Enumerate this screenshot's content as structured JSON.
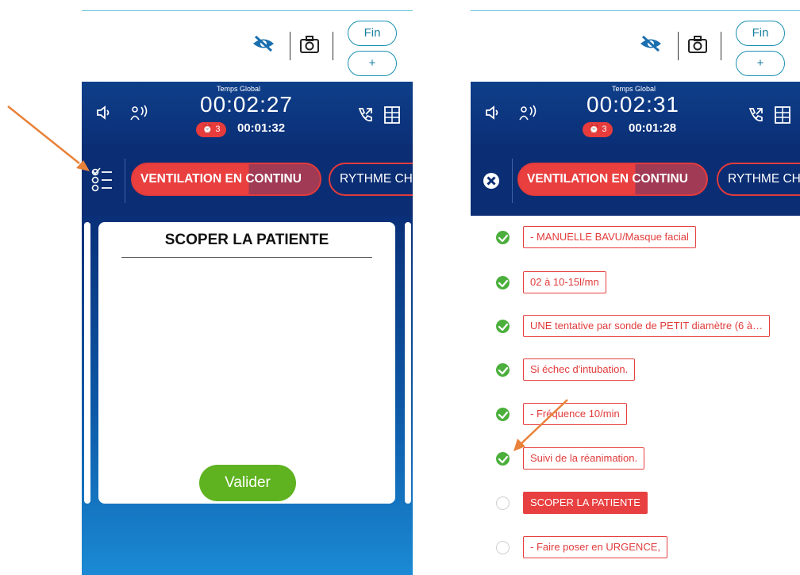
{
  "left_screen": {
    "top": {
      "end_label": "Fin",
      "add_label": "+"
    },
    "header": {
      "global_time_label": "Temps Global",
      "global_timer": "00:02:27",
      "alarm_count": "3",
      "sub_timer": "00:01:32"
    },
    "tabs": {
      "active": "VENTILATION EN CONTINU",
      "next": "RYTHME CH"
    },
    "card": {
      "title": "SCOPER LA PATIENTE",
      "validate_label": "Valider"
    }
  },
  "right_screen": {
    "top": {
      "end_label": "Fin",
      "add_label": "+"
    },
    "header": {
      "global_time_label": "Temps Global",
      "global_timer": "00:02:31",
      "alarm_count": "3",
      "sub_timer": "00:01:28"
    },
    "tabs": {
      "active": "VENTILATION EN CONTINU",
      "next": "RYTHME CH"
    },
    "checklist": [
      {
        "label": "- MANUELLE BAVU/Masque facial",
        "done": true
      },
      {
        "label": "02 à 10-15l/mn",
        "done": true
      },
      {
        "label": "UNE tentative par sonde de PETIT diamètre (6 à…",
        "done": true
      },
      {
        "label": "Si échec d'intubation.",
        "done": true
      },
      {
        "label": "- Fréquence 10/min",
        "done": true
      },
      {
        "label": "Suivi de la réanimation.",
        "done": true
      },
      {
        "label": "SCOPER LA PATIENTE",
        "done": false,
        "highlighted": true
      },
      {
        "label": "- Faire poser en URGENCE,",
        "done": false
      }
    ]
  },
  "colors": {
    "brand_blue": "#0b2d73",
    "alert_red": "#e83b3b",
    "check_green": "#4caf3d",
    "accent_cyan": "#1a8fb0",
    "annotation_orange": "#e8823a"
  }
}
